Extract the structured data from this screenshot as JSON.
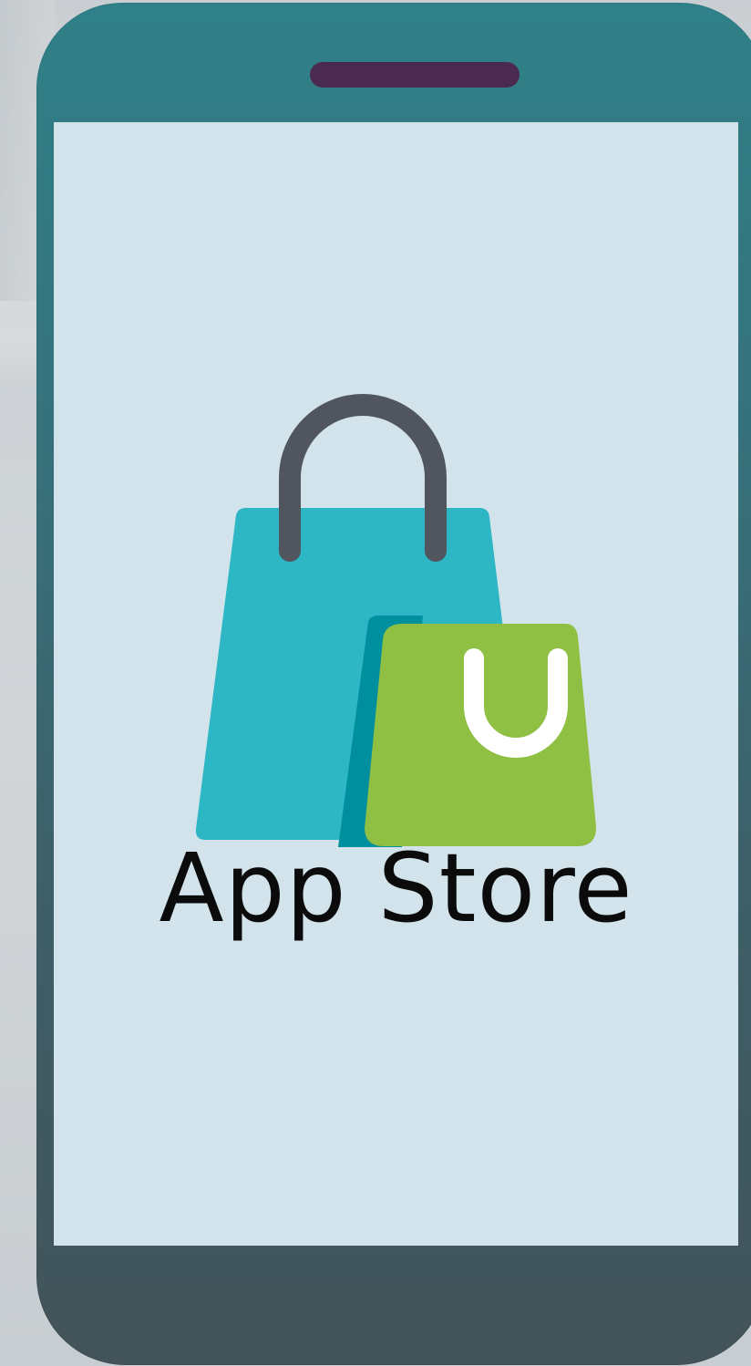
{
  "app": {
    "title": "App Store"
  },
  "icons": {
    "shopping_bags": "shopping-bags-logo-icon",
    "speaker": "phone-speaker-icon"
  },
  "colors": {
    "phone_top": "#2f8088",
    "phone_bottom": "#425359",
    "speaker": "#4a2a4f",
    "screen": "#d2e3eb",
    "bag_blue": "#2db6c4",
    "bag_blue_shadow": "#008f9e",
    "bag_green": "#8fc043",
    "bag_handle": "#51555d",
    "text": "#0b0b0b"
  }
}
